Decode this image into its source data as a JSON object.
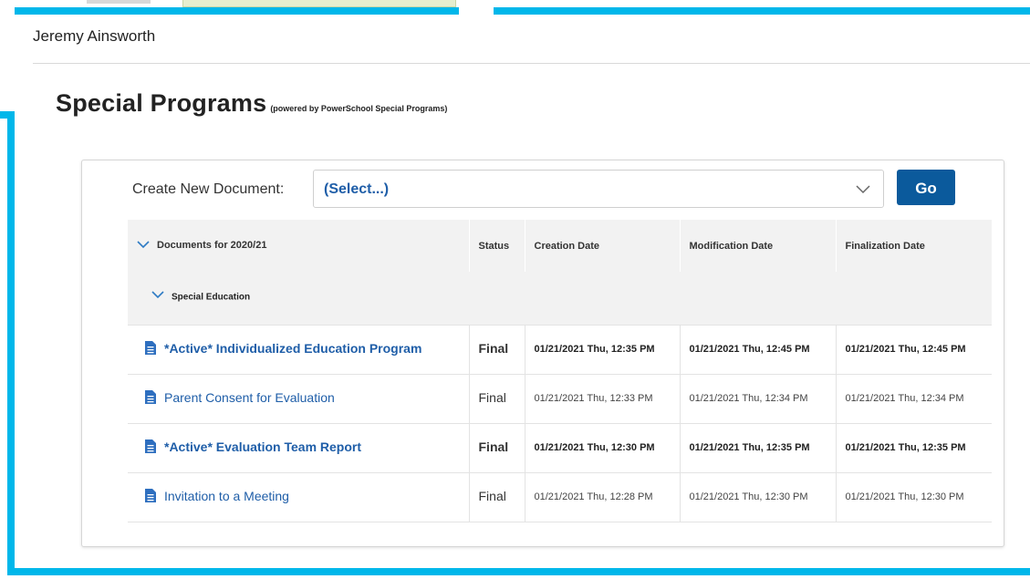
{
  "header": {
    "student_name": "Jeremy Ainsworth"
  },
  "page": {
    "title": "Special Programs",
    "subtitle": "(powered by PowerSchool Special Programs)"
  },
  "create_document": {
    "label": "Create New Document:",
    "selected": "(Select...)",
    "go_label": "Go"
  },
  "table": {
    "columns": [
      "Documents for 2020/21",
      "Status",
      "Creation Date",
      "Modification Date",
      "Finalization Date"
    ],
    "group": "Special Education",
    "rows": [
      {
        "name": "*Active* Individualized Education Program",
        "status": "Final",
        "created": "01/21/2021 Thu, 12:35 PM",
        "modified": "01/21/2021 Thu, 12:45 PM",
        "finalized": "01/21/2021 Thu, 12:45 PM",
        "active": true
      },
      {
        "name": "Parent Consent for Evaluation",
        "status": "Final",
        "created": "01/21/2021 Thu, 12:33 PM",
        "modified": "01/21/2021 Thu, 12:34 PM",
        "finalized": "01/21/2021 Thu, 12:34 PM",
        "active": false
      },
      {
        "name": "*Active* Evaluation Team Report",
        "status": "Final",
        "created": "01/21/2021 Thu, 12:30 PM",
        "modified": "01/21/2021 Thu, 12:35 PM",
        "finalized": "01/21/2021 Thu, 12:35 PM",
        "active": true
      },
      {
        "name": "Invitation to a Meeting",
        "status": "Final",
        "created": "01/21/2021 Thu, 12:28 PM",
        "modified": "01/21/2021 Thu, 12:30 PM",
        "finalized": "01/21/2021 Thu, 12:30 PM",
        "active": false
      }
    ]
  },
  "colors": {
    "accent_border": "#00b7ea",
    "link": "#1f5ea8",
    "button": "#0b5a9c",
    "header_bg": "#f2f2f2"
  },
  "icons": [
    "chevron-down-icon",
    "document-icon"
  ]
}
